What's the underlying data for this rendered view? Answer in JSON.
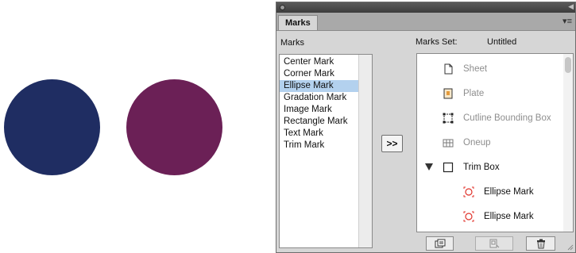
{
  "colors": {
    "circle_left": "#1f2d62",
    "circle_right": "#6b2056",
    "selection": "#b3d1ee",
    "mark_icon_red": "#e0322a"
  },
  "panel": {
    "tab_label": "Marks",
    "menu_icon": "panel-menu-icon",
    "marks_heading": "Marks",
    "marks_set_label": "Marks Set:",
    "marks_set_value": "Untitled",
    "marks_list": [
      "Center Mark",
      "Corner Mark",
      "Ellipse Mark",
      "Gradation Mark",
      "Image Mark",
      "Rectangle Mark",
      "Text Mark",
      "Trim Mark"
    ],
    "selected_index": 2,
    "add_button_label": ">>",
    "tree": {
      "sheet": "Sheet",
      "plate": "Plate",
      "outline": "Cutline Bounding Box",
      "oneup": "Oneup",
      "trimbox": "Trim Box",
      "mark1": "Ellipse Mark",
      "mark2": "Ellipse Mark"
    }
  }
}
